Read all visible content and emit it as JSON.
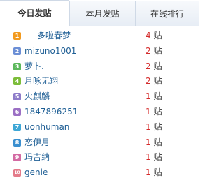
{
  "tabs": [
    "今日发贴",
    "本月发贴",
    "在线排行"
  ],
  "unit": "贴",
  "rows": [
    {
      "rank": "1",
      "name": "___多啦春梦",
      "count": "4",
      "color": "#f29a1f"
    },
    {
      "rank": "2",
      "name": "mizuno1001",
      "count": "2",
      "color": "#6c8fd6"
    },
    {
      "rank": "3",
      "name": "萝卜.",
      "count": "2",
      "color": "#5cb85c"
    },
    {
      "rank": "4",
      "name": "月咏无翔",
      "count": "2",
      "color": "#7cbd3a"
    },
    {
      "rank": "5",
      "name": "火麒麟",
      "count": "1",
      "color": "#8e7cc9"
    },
    {
      "rank": "6",
      "name": "1847896251",
      "count": "1",
      "color": "#9b6fc4"
    },
    {
      "rank": "7",
      "name": "uonhuman",
      "count": "1",
      "color": "#3ea7d6"
    },
    {
      "rank": "8",
      "name": "恋伊月",
      "count": "1",
      "color": "#3a8fcf"
    },
    {
      "rank": "9",
      "name": "玛吉纳",
      "count": "1",
      "color": "#d36aa3"
    },
    {
      "rank": "10",
      "name": "genie",
      "count": "1",
      "color": "#e47b8a"
    }
  ]
}
